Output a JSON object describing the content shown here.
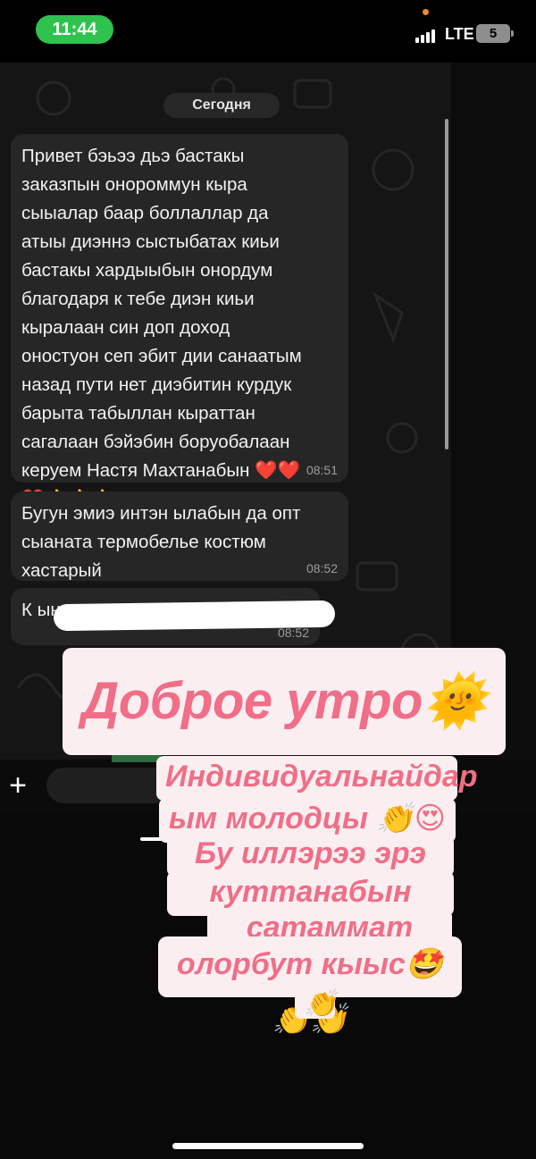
{
  "status_bar": {
    "time": "11:44",
    "network": "LTE",
    "battery": "5",
    "colors": {
      "time_pill": "#2fc24f",
      "dot": "#e98b2f"
    }
  },
  "chat": {
    "date_divider": "Сегодня",
    "messages": [
      {
        "text": "Привет бэьээ дьэ бастакы\nзаказпын онороммун кыра\nсыыалар баар боллаллар да\nатыы диэннэ сыстыбатах киьи\nбастакы хардыыбын онордум\nблагодаря к тебе диэн киьи\nкыралаан син доп доход\nоностуон сеп эбит дии санаатым\nназад пути нет диэбитин курдук\nбарыта табыллан кыраттан\nсагалаан бэйэбин боруобалаан\nкеруем Настя Махтанабын ❤️❤️\n❤️👍👍👍",
        "time": "08:51"
      },
      {
        "text": "Бугун эмиэ интэн ылабын да опт\nсыаната термобелье костюм\nхастарый",
        "time": "08:52"
      },
      {
        "text": "К                                             ын",
        "time": "08:52"
      }
    ]
  },
  "composer": {
    "attach_icon": "plus-icon"
  },
  "stickers": {
    "title": "Доброе утро🌞🥰",
    "lines": [
      "Индивидуальнайдар",
      "ым молодцы 👏😍",
      "Бу иллэрээ эрэ кун",
      "куттанабын миэхэ",
      "сатаммат дии",
      "олорбут кыыс🤩👏👏",
      "👏"
    ],
    "colors": {
      "bg": "#fbeef1",
      "text": "#f06e87"
    }
  }
}
